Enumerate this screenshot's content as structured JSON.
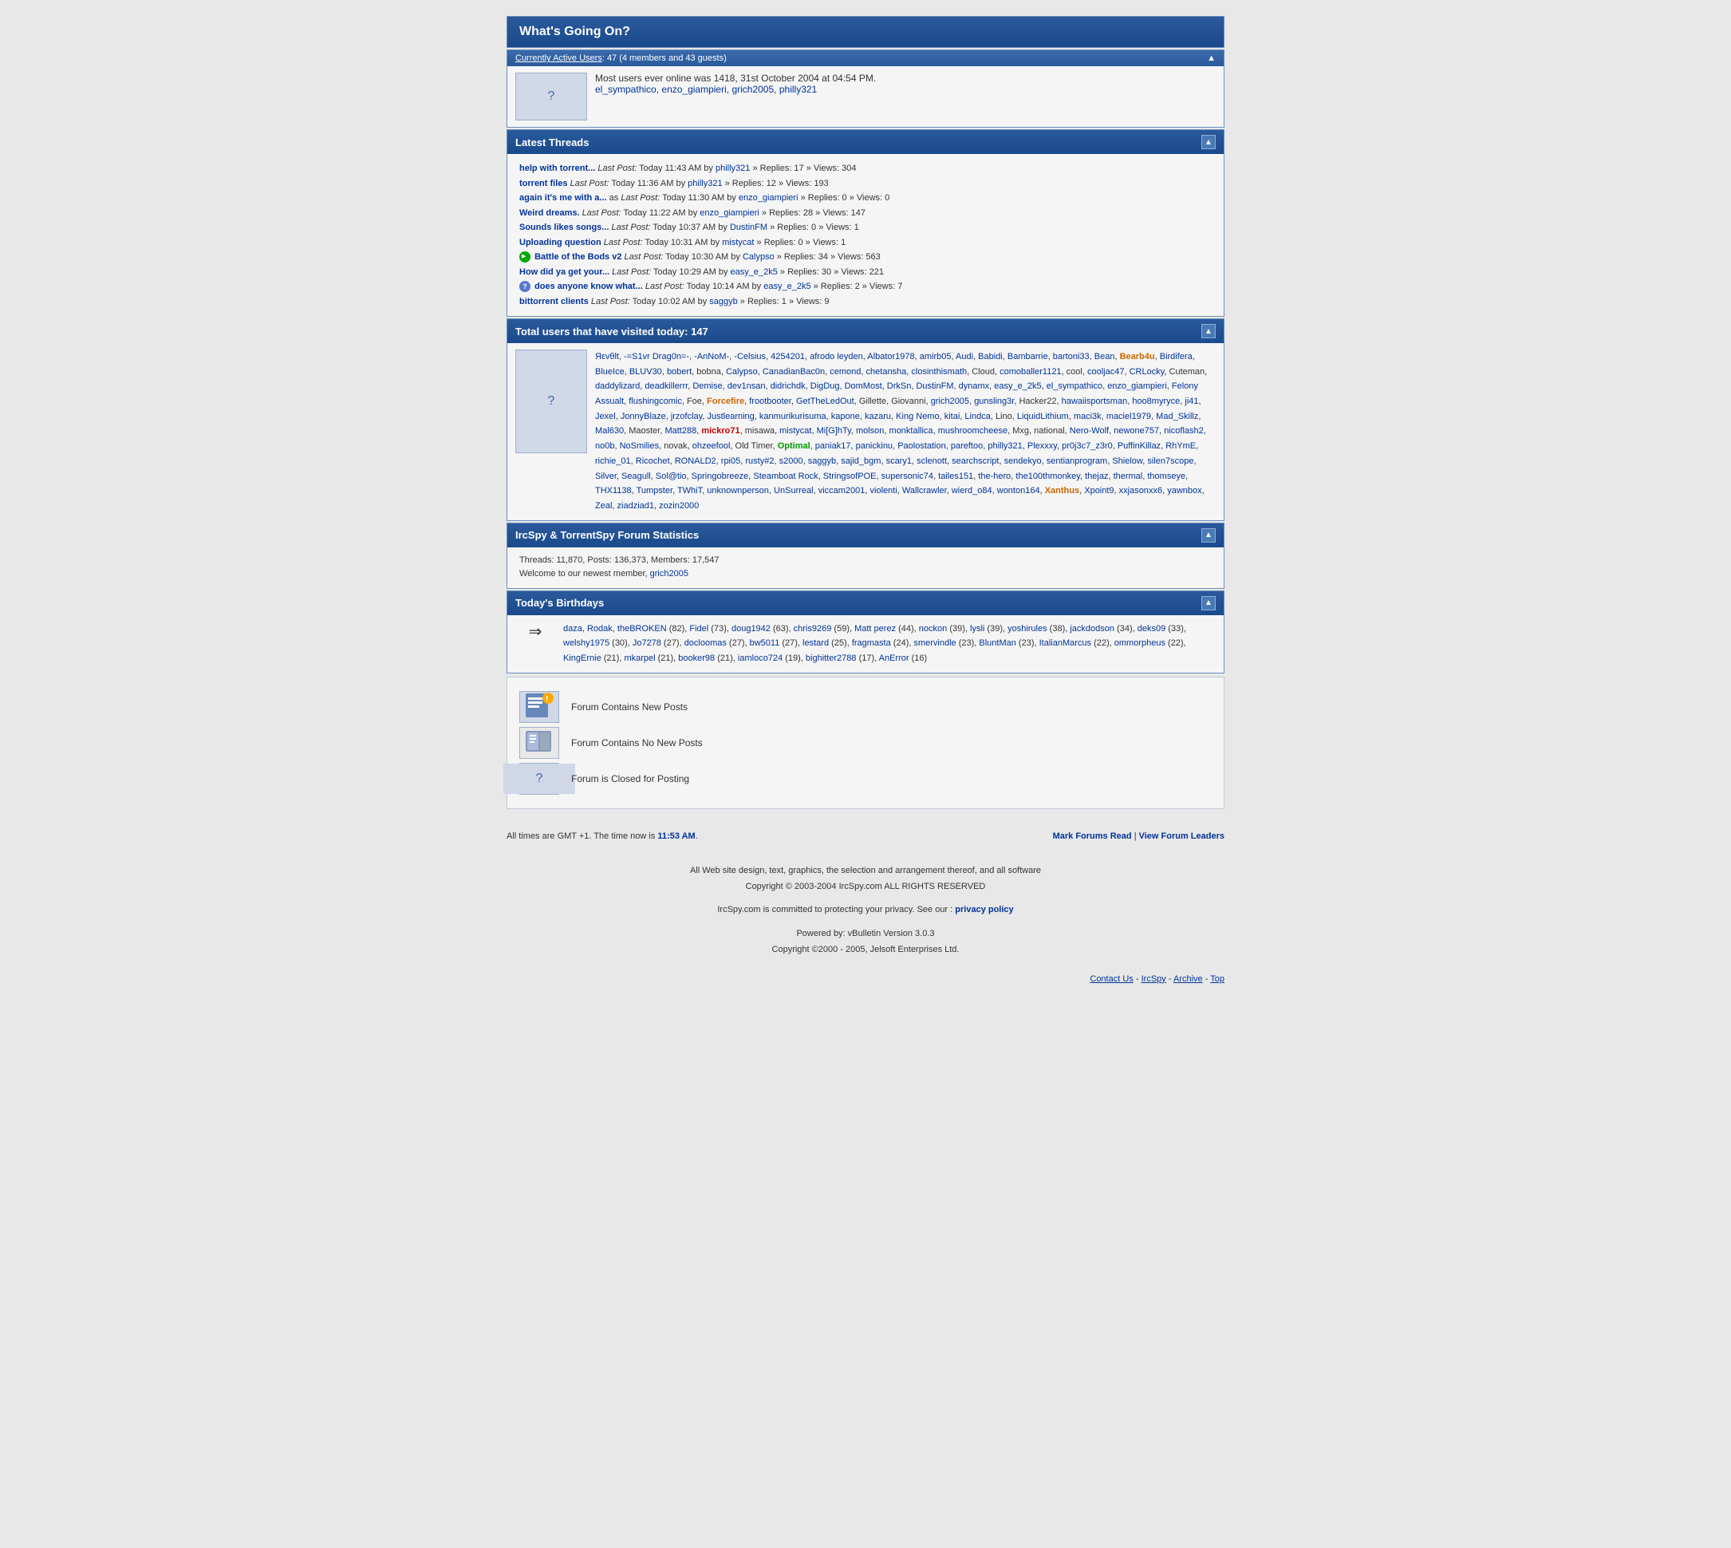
{
  "page": {
    "title": "What's Going On?",
    "active_users_header": "Currently Active Users",
    "active_users_count": "47 (4 members and 43 guests)",
    "max_online": "Most users ever online was 1418, 31st October 2004 at 04:54 PM.",
    "max_online_users": "el_sympathico, enzo_giampieri, grich2005, philly321",
    "latest_threads_header": "Latest Threads",
    "threads": [
      {
        "title": "help with torrent...",
        "last_post": "Last Post:",
        "time": "Today 11:43 AM",
        "by": "by",
        "user": "philly321",
        "replies": "Replies: 17",
        "views": "Views: 304",
        "icon": "none"
      },
      {
        "title": "torrent files",
        "last_post": "Last Post:",
        "time": "Today 11:36 AM",
        "by": "by",
        "user": "philly321",
        "replies": "Replies: 12",
        "views": "Views: 193",
        "icon": "none"
      },
      {
        "title": "again it's me with a...",
        "last_post": "as Last Post:",
        "time": "Today 11:30 AM",
        "by": "by",
        "user": "enzo_giampieri",
        "replies": "Replies: 0",
        "views": "Views: 0",
        "icon": "none"
      },
      {
        "title": "Weird dreams.",
        "last_post": "Last Post:",
        "time": "Today 11:22 AM",
        "by": "by",
        "user": "enzo_giampieri",
        "replies": "Replies: 28",
        "views": "Views: 147",
        "icon": "none"
      },
      {
        "title": "Sounds likes songs...",
        "last_post": "Last Post:",
        "time": "Today 10:37 AM",
        "by": "by",
        "user": "DustinFM",
        "replies": "Replies: 0",
        "views": "Views: 1",
        "icon": "none"
      },
      {
        "title": "Uploading question",
        "last_post": "Last Post:",
        "time": "Today 10:31 AM",
        "by": "by",
        "user": "mistycat",
        "replies": "Replies: 0",
        "views": "Views: 1",
        "icon": "none"
      },
      {
        "title": "Battle of the Bods v2",
        "last_post": "Last Post:",
        "time": "Today 10:30 AM",
        "by": "by",
        "user": "Calypso",
        "replies": "Replies: 34",
        "views": "Views: 563",
        "icon": "green"
      },
      {
        "title": "How did ya get your...",
        "last_post": "Last Post:",
        "time": "Today 10:29 AM",
        "by": "by",
        "user": "easy_e_2k5",
        "replies": "Replies: 30",
        "views": "Views: 221",
        "icon": "none"
      },
      {
        "title": "does anyone know what...",
        "last_post": "Last Post:",
        "time": "Today 10:14 AM",
        "by": "by",
        "user": "easy_e_2k5",
        "replies": "Replies: 2",
        "views": "Views: 7",
        "icon": "question"
      },
      {
        "title": "bittorrent clients",
        "last_post": "Last Post:",
        "time": "Today 10:02 AM",
        "by": "by",
        "user": "saggyb",
        "replies": "Replies: 1",
        "views": "Views: 9",
        "icon": "none"
      }
    ],
    "total_visitors_header": "Total users that have visited today: 147",
    "visitors": "Яεvθlt, -=S1vr Drag0n=-, -AnNoM-, -Celsius, 4254201, afrodo leyden, Albator1978, amirb05, Audi, Babidi, Bambarrie, bartoni33, Bean, Bearb4u, Birdifera, BlueIce, BLUV30, bobert, bobna, Calypso, CanadianBac0n, cemond, chetansha, closinthismath, Cloud, comoballer1121, cool, cooljac47, CRLocky, Cuteman, daddylizard, deadkillerrr, Demise, dev1nsan, didrichdk, DigDug, DomMost, DrkSn, DustinFM, dynamx, easy_e_2k5, el_sympathico, enzo_giampieri, Felony Assualt, flushingcomic, Foe, Forcefire, frootbooter, GetTheLedOut, Gillette, Giovanni, grich2005, gunsling3r, Hacker22, hawaiisportsman, hoo8myryce, ji41, Jexel, JonnyBlaze, jrzofclay, Justlearning, kanmurikurisuma, kapone, kazaru, King Nemo, kitai, Lindca, Lino, LiquidLithium, maci3k, maciel1979, Mad_Skillz, Mal630, Maoster, Matt288, mickro71, misawa, mistycat, Mi[G]hTy, molson, monktallica, mushroomcheese, Mxg, national, Nero-Wolf, newone757, nicoflash2, no0b, NoSmilies, novak, ohzeefool, Old Timer, Optimal, paniak17, panickinu, Paolostation, pareftoo, philly321, Plexxxy, pr0j3c7_z3r0, PuffinKillaz, RhYmE, richie_01, Ricochet, RONALD2, rpi05, rusty#2, s2000, saggyb, sajid_bgm, scary1, sclenott, searchscript, sendekyo, sentianprogram, Shielow, silen7scope, Silver, Seagull, Sol@tio, Springobreeze, Steamboat Rock, StringsofPOE, supersonic74, tailes151, the-hero, the100thmonkey, thejaz, thermal, thomseye, THX1138, Tumpster, TWhiT, unknownperson, UnSurreal, viccam2001, violent, Wallcrawler, wierd_o84, wonton164, Xanthus, Xpoint9, xxjasonxx6, yawnbox, Zeal, ziadziad1, zozin2000",
    "stats_header": "IrcSpy & TorrentSpy Forum Statistics",
    "stats_threads": "11,870",
    "stats_posts": "136,373",
    "stats_members": "17,547",
    "stats_newest": "grich2005",
    "birthdays_header": "Today's Birthdays",
    "birthdays": "daza, Rodak, theBROKEN (82), Fidel (73), doug1942 (63), chris9269 (59), Matt perez (44), nockon (39), lysli (39), yoshirules (38), jackdodson (34), deks09 (33), welshy1975 (30), Jo7278 (27), docloomas (27), bw5011 (27), lestard (25), fragmasta (24), smervindle (23), BluntMan (23), ItalianMarcus (22), ommorpheus (22), KingErnie (21), mkarpel (21), booker98 (21), iamloco724 (19), bighitter2788 (17), AnError (16)",
    "legend_new_posts": "Forum Contains New Posts",
    "legend_no_new_posts": "Forum Contains No New Posts",
    "legend_closed": "Forum is Closed for Posting",
    "footer_timezone": "All times are GMT +1. The time now is",
    "footer_time": "11:53 AM",
    "footer_mark": "Mark Forums Read",
    "footer_view_leaders": "View Forum Leaders",
    "footer_copyright": "All Web site design, text, graphics, the selection and arrangement thereof, and all software",
    "footer_copyright2": "Copyright © 2003-2004 IrcSpy.com ALL RIGHTS RESERVED",
    "footer_privacy": "IrcSpy.com is committed to protecting your privacy. See our :",
    "footer_privacy_link": "privacy policy",
    "footer_powered": "Powered by: vBulletin Version 3.0.3",
    "footer_powered2": "Copyright ©2000 - 2005, Jelsoft Enterprises Ltd.",
    "footer_contact": "Contact Us",
    "footer_ircspy": "IrcSpy",
    "footer_archive": "Archive",
    "footer_top": "Top"
  }
}
